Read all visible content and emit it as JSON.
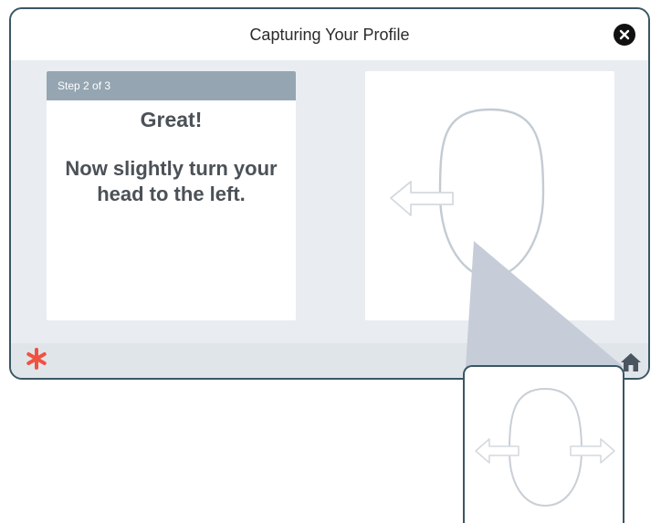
{
  "modal": {
    "title": "Capturing Your Profile"
  },
  "instruction_card": {
    "step_label": "Step 2 of 3",
    "heading": "Great!",
    "instruction": "Now slightly turn your head to the left."
  },
  "illustration": {
    "head_outline": "head-outline-icon",
    "arrow_direction": "left"
  },
  "zoom_detail": {
    "arrows": [
      "left",
      "right"
    ]
  },
  "icons": {
    "close": "close-icon",
    "home": "home-icon",
    "brand": "asterisk-logo-icon"
  },
  "colors": {
    "border": "#3a5663",
    "step_bar": "#95a6b2",
    "panel_bg": "#e9edf1",
    "brand_asterisk": "#f0523f",
    "callout": "#c6cdd8",
    "heading_text": "#4b5157"
  }
}
